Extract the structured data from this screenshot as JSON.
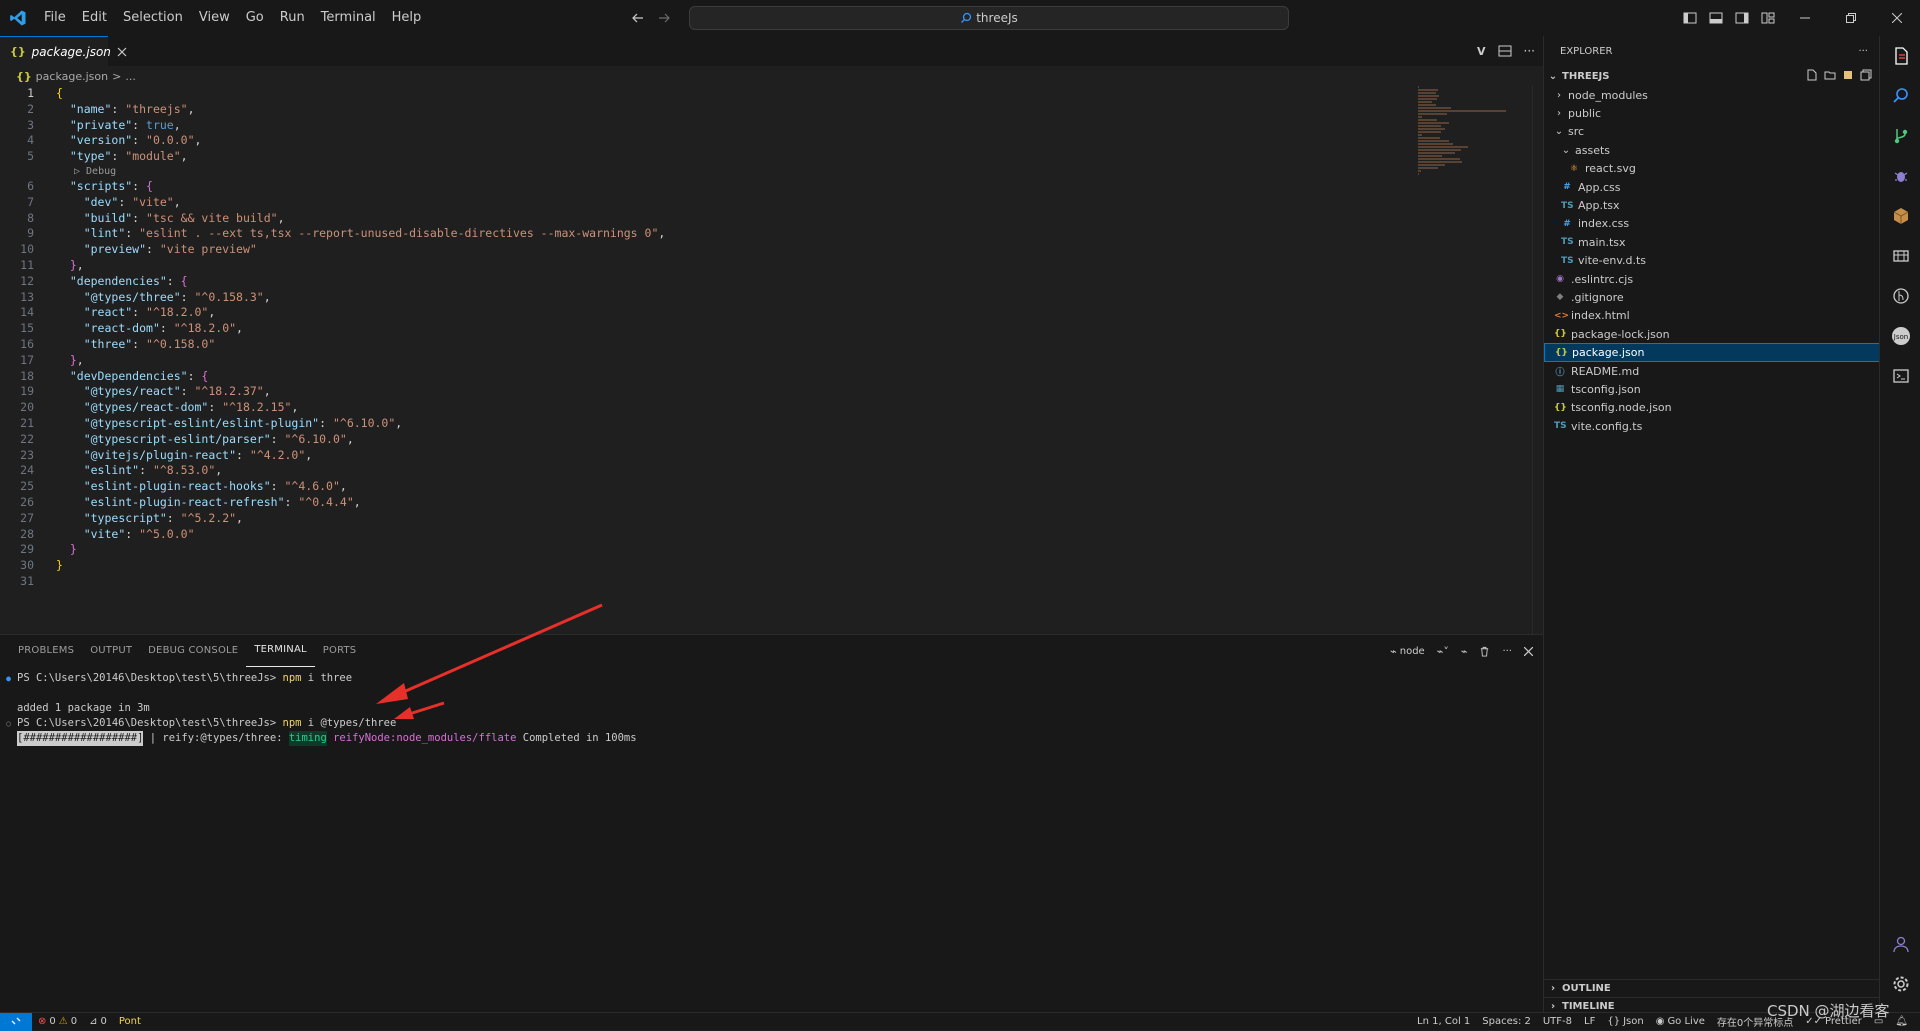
{
  "menu": [
    "File",
    "Edit",
    "Selection",
    "View",
    "Go",
    "Run",
    "Terminal",
    "Help"
  ],
  "command_center": {
    "text": "threeJs"
  },
  "tab": {
    "label": "package.json",
    "icon": "json-icon"
  },
  "breadcrumb": {
    "file": "package.json",
    "sep": ">",
    "more": "..."
  },
  "editor": {
    "codelens": "Debug",
    "lines": [
      {
        "n": "1",
        "t": "{"
      },
      {
        "n": "2",
        "t": "  \"name\": \"threejs\","
      },
      {
        "n": "3",
        "t": "  \"private\": true,"
      },
      {
        "n": "4",
        "t": "  \"version\": \"0.0.0\","
      },
      {
        "n": "5",
        "t": "  \"type\": \"module\","
      },
      {
        "n": "6",
        "t": "  \"scripts\": {"
      },
      {
        "n": "7",
        "t": "    \"dev\": \"vite\","
      },
      {
        "n": "8",
        "t": "    \"build\": \"tsc && vite build\","
      },
      {
        "n": "9",
        "t": "    \"lint\": \"eslint . --ext ts,tsx --report-unused-disable-directives --max-warnings 0\","
      },
      {
        "n": "10",
        "t": "    \"preview\": \"vite preview\""
      },
      {
        "n": "11",
        "t": "  },"
      },
      {
        "n": "12",
        "t": "  \"dependencies\": {"
      },
      {
        "n": "13",
        "t": "    \"@types/three\": \"^0.158.3\","
      },
      {
        "n": "14",
        "t": "    \"react\": \"^18.2.0\","
      },
      {
        "n": "15",
        "t": "    \"react-dom\": \"^18.2.0\","
      },
      {
        "n": "16",
        "t": "    \"three\": \"^0.158.0\""
      },
      {
        "n": "17",
        "t": "  },"
      },
      {
        "n": "18",
        "t": "  \"devDependencies\": {"
      },
      {
        "n": "19",
        "t": "    \"@types/react\": \"^18.2.37\","
      },
      {
        "n": "20",
        "t": "    \"@types/react-dom\": \"^18.2.15\","
      },
      {
        "n": "21",
        "t": "    \"@typescript-eslint/eslint-plugin\": \"^6.10.0\","
      },
      {
        "n": "22",
        "t": "    \"@typescript-eslint/parser\": \"^6.10.0\","
      },
      {
        "n": "23",
        "t": "    \"@vitejs/plugin-react\": \"^4.2.0\","
      },
      {
        "n": "24",
        "t": "    \"eslint\": \"^8.53.0\","
      },
      {
        "n": "25",
        "t": "    \"eslint-plugin-react-hooks\": \"^4.6.0\","
      },
      {
        "n": "26",
        "t": "    \"eslint-plugin-react-refresh\": \"^0.4.4\","
      },
      {
        "n": "27",
        "t": "    \"typescript\": \"^5.2.2\","
      },
      {
        "n": "28",
        "t": "    \"vite\": \"^5.0.0\""
      },
      {
        "n": "29",
        "t": "  }"
      },
      {
        "n": "30",
        "t": "}"
      },
      {
        "n": "31",
        "t": ""
      }
    ]
  },
  "panel": {
    "tabs": [
      "PROBLEMS",
      "OUTPUT",
      "DEBUG CONSOLE",
      "TERMINAL",
      "PORTS"
    ],
    "active_tab": "TERMINAL",
    "terminal_name": "node"
  },
  "terminal": {
    "prompt1": "PS C:\\Users\\20146\\Desktop\\test\\5\\threeJs> ",
    "cmd1_npm": "npm",
    "cmd1_rest": " i three",
    "output1": "added 1 package in 3m",
    "prompt2": "PS C:\\Users\\20146\\Desktop\\test\\5\\threeJs> ",
    "cmd2_npm": "npm",
    "cmd2_rest": " i @types/three",
    "progress_bar": "[##################]",
    "progress_mid": " | reify:@types/three: ",
    "timing": "timing",
    "reify_node": " reifyNode:node_modules/fflate",
    "completed": " Completed in 100ms"
  },
  "explorer": {
    "header": "EXPLORER",
    "project": "THREEJS",
    "items": [
      {
        "label": "node_modules",
        "type": "folder",
        "open": false,
        "depth": 1
      },
      {
        "label": "public",
        "type": "folder",
        "open": false,
        "depth": 1
      },
      {
        "label": "src",
        "type": "folder",
        "open": true,
        "depth": 1
      },
      {
        "label": "assets",
        "type": "folder",
        "open": true,
        "depth": 2
      },
      {
        "label": "react.svg",
        "type": "svg",
        "depth": 3
      },
      {
        "label": "App.css",
        "type": "css",
        "depth": 2
      },
      {
        "label": "App.tsx",
        "type": "ts",
        "depth": 2
      },
      {
        "label": "index.css",
        "type": "css",
        "depth": 2
      },
      {
        "label": "main.tsx",
        "type": "ts",
        "depth": 2
      },
      {
        "label": "vite-env.d.ts",
        "type": "ts",
        "depth": 2
      },
      {
        "label": ".eslintrc.cjs",
        "type": "eslint",
        "depth": 1
      },
      {
        "label": ".gitignore",
        "type": "git",
        "depth": 1
      },
      {
        "label": "index.html",
        "type": "html",
        "depth": 1
      },
      {
        "label": "package-lock.json",
        "type": "json",
        "depth": 1
      },
      {
        "label": "package.json",
        "type": "json",
        "depth": 1,
        "selected": true
      },
      {
        "label": "README.md",
        "type": "md",
        "depth": 1
      },
      {
        "label": "tsconfig.json",
        "type": "cfg",
        "depth": 1
      },
      {
        "label": "tsconfig.node.json",
        "type": "json",
        "depth": 1
      },
      {
        "label": "vite.config.ts",
        "type": "ts",
        "depth": 1
      }
    ],
    "outline": "OUTLINE",
    "timeline": "TIMELINE"
  },
  "statusbar": {
    "errors": "0",
    "warnings": "0",
    "ports": "0",
    "font": "Pont",
    "position": "Ln 1, Col 1",
    "spaces": "Spaces: 2",
    "encoding": "UTF-8",
    "eol": "LF",
    "language": "Json",
    "golive": "Go Live",
    "problems_note": "存在0个异常标点",
    "prettier": "Prettier"
  },
  "watermark": "CSDN @湖边看客",
  "colors": {
    "accent": "#0078d4",
    "background": "#1f1f1f",
    "sidebar": "#181818",
    "arrow": "#e8302a"
  }
}
